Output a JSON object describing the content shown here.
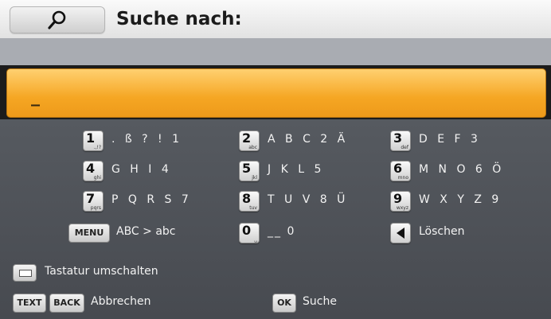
{
  "header": {
    "title": "Suche nach:",
    "icon": "search-icon"
  },
  "input": {
    "value": "_"
  },
  "keypad": {
    "keys": [
      {
        "num": "1",
        "sub": ".,!?",
        "label": ". ß ? ! 1"
      },
      {
        "num": "2",
        "sub": "abc",
        "label": "A B C 2 Ä"
      },
      {
        "num": "3",
        "sub": "def",
        "label": "D E F 3"
      },
      {
        "num": "4",
        "sub": "ghi",
        "label": "G H I 4"
      },
      {
        "num": "5",
        "sub": "jkl",
        "label": "J K L 5"
      },
      {
        "num": "6",
        "sub": "mno",
        "label": "M N O 6 Ö"
      },
      {
        "num": "7",
        "sub": "pqrs",
        "label": "P Q R S 7"
      },
      {
        "num": "8",
        "sub": "tuv",
        "label": "T U V 8 Ü"
      },
      {
        "num": "9",
        "sub": "wxyz",
        "label": "W X Y Z 9"
      }
    ],
    "menu": {
      "button": "MENU",
      "label": "ABC > abc"
    },
    "zero": {
      "num": "0",
      "sub": "␣",
      "label": "__ 0"
    },
    "delete": {
      "label": "Löschen"
    }
  },
  "footer": {
    "toggle_label": "Tastatur umschalten",
    "text_button": "TEXT",
    "back_button": "BACK",
    "cancel_label": "Abbrechen",
    "ok_button": "OK",
    "search_label": "Suche"
  },
  "colors": {
    "input_orange": "#f5a623",
    "panel_gray": "#4e5257",
    "header_strip": "#a9acb2"
  }
}
